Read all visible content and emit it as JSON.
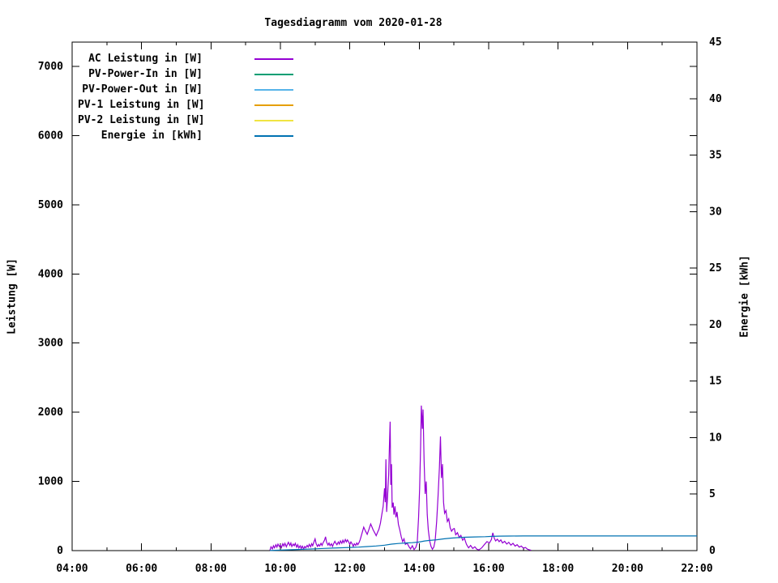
{
  "chart_data": {
    "type": "line",
    "title": "Tagesdiagramm vom 2020-01-28",
    "ylabel": "Leistung [W]",
    "y2label": "Energie [kWh]",
    "grid": false,
    "legend_position": "top-left",
    "x_range": [
      4,
      22
    ],
    "y_range": [
      0,
      7351
    ],
    "y2_range": [
      0,
      45
    ],
    "x_ticks": [
      {
        "h": 4,
        "label": "04:00"
      },
      {
        "h": 6,
        "label": "06:00"
      },
      {
        "h": 8,
        "label": "08:00"
      },
      {
        "h": 10,
        "label": "10:00"
      },
      {
        "h": 12,
        "label": "12:00"
      },
      {
        "h": 14,
        "label": "14:00"
      },
      {
        "h": 16,
        "label": "16:00"
      },
      {
        "h": 18,
        "label": "18:00"
      },
      {
        "h": 20,
        "label": "20:00"
      },
      {
        "h": 22,
        "label": "22:00"
      }
    ],
    "x_minor_ticks": [
      5,
      7,
      9,
      11,
      13,
      15,
      17,
      19,
      21
    ],
    "y_ticks": [
      {
        "v": 0,
        "label": "0"
      },
      {
        "v": 1000,
        "label": "1000"
      },
      {
        "v": 2000,
        "label": "2000"
      },
      {
        "v": 3000,
        "label": "3000"
      },
      {
        "v": 4000,
        "label": "4000"
      },
      {
        "v": 5000,
        "label": "5000"
      },
      {
        "v": 6000,
        "label": "6000"
      },
      {
        "v": 7000,
        "label": "7000"
      }
    ],
    "y2_ticks": [
      {
        "v": 0,
        "label": "0"
      },
      {
        "v": 5,
        "label": "5"
      },
      {
        "v": 10,
        "label": "10"
      },
      {
        "v": 15,
        "label": "15"
      },
      {
        "v": 20,
        "label": "20"
      },
      {
        "v": 25,
        "label": "25"
      },
      {
        "v": 30,
        "label": "30"
      },
      {
        "v": 35,
        "label": "35"
      },
      {
        "v": 40,
        "label": "40"
      },
      {
        "v": 45,
        "label": "45"
      }
    ],
    "series": [
      {
        "name": "AC Leistung in [W]",
        "color": "#9400d3",
        "axis": "y1",
        "points": [
          [
            9.7,
            5
          ],
          [
            9.73,
            55
          ],
          [
            9.77,
            25
          ],
          [
            9.8,
            70
          ],
          [
            9.83,
            40
          ],
          [
            9.87,
            85
          ],
          [
            9.9,
            50
          ],
          [
            9.93,
            95
          ],
          [
            9.97,
            60
          ],
          [
            10.0,
            80
          ],
          [
            10.03,
            45
          ],
          [
            10.07,
            100
          ],
          [
            10.1,
            65
          ],
          [
            10.13,
            105
          ],
          [
            10.17,
            55
          ],
          [
            10.2,
            90
          ],
          [
            10.23,
            120
          ],
          [
            10.27,
            75
          ],
          [
            10.3,
            110
          ],
          [
            10.33,
            60
          ],
          [
            10.37,
            95
          ],
          [
            10.4,
            70
          ],
          [
            10.43,
            105
          ],
          [
            10.47,
            50
          ],
          [
            10.5,
            85
          ],
          [
            10.53,
            40
          ],
          [
            10.57,
            70
          ],
          [
            10.6,
            30
          ],
          [
            10.63,
            65
          ],
          [
            10.67,
            25
          ],
          [
            10.7,
            60
          ],
          [
            10.73,
            40
          ],
          [
            10.77,
            75
          ],
          [
            10.8,
            50
          ],
          [
            10.83,
            90
          ],
          [
            10.87,
            55
          ],
          [
            10.9,
            100
          ],
          [
            10.93,
            70
          ],
          [
            10.97,
            130
          ],
          [
            11.0,
            170
          ],
          [
            11.03,
            100
          ],
          [
            11.07,
            60
          ],
          [
            11.1,
            90
          ],
          [
            11.13,
            65
          ],
          [
            11.17,
            105
          ],
          [
            11.2,
            75
          ],
          [
            11.23,
            115
          ],
          [
            11.27,
            150
          ],
          [
            11.3,
            200
          ],
          [
            11.33,
            120
          ],
          [
            11.37,
            80
          ],
          [
            11.4,
            110
          ],
          [
            11.43,
            70
          ],
          [
            11.47,
            100
          ],
          [
            11.5,
            60
          ],
          [
            11.53,
            95
          ],
          [
            11.57,
            135
          ],
          [
            11.6,
            105
          ],
          [
            11.63,
            85
          ],
          [
            11.67,
            125
          ],
          [
            11.7,
            95
          ],
          [
            11.73,
            140
          ],
          [
            11.77,
            105
          ],
          [
            11.8,
            150
          ],
          [
            11.83,
            115
          ],
          [
            11.87,
            160
          ],
          [
            11.9,
            125
          ],
          [
            11.93,
            155
          ],
          [
            11.97,
            120
          ],
          [
            12.0,
            90
          ],
          [
            12.03,
            125
          ],
          [
            12.07,
            95
          ],
          [
            12.1,
            60
          ],
          [
            12.13,
            100
          ],
          [
            12.17,
            75
          ],
          [
            12.2,
            110
          ],
          [
            12.23,
            85
          ],
          [
            12.27,
            120
          ],
          [
            12.3,
            160
          ],
          [
            12.35,
            250
          ],
          [
            12.4,
            340
          ],
          [
            12.45,
            285
          ],
          [
            12.5,
            235
          ],
          [
            12.55,
            305
          ],
          [
            12.6,
            385
          ],
          [
            12.63,
            350
          ],
          [
            12.67,
            300
          ],
          [
            12.72,
            255
          ],
          [
            12.76,
            215
          ],
          [
            12.8,
            265
          ],
          [
            12.84,
            310
          ],
          [
            12.88,
            395
          ],
          [
            12.92,
            520
          ],
          [
            12.96,
            640
          ],
          [
            13.0,
            900
          ],
          [
            13.02,
            700
          ],
          [
            13.04,
            1320
          ],
          [
            13.06,
            560
          ],
          [
            13.09,
            820
          ],
          [
            13.12,
            1100
          ],
          [
            13.14,
            1500
          ],
          [
            13.16,
            1863
          ],
          [
            13.18,
            950
          ],
          [
            13.2,
            1250
          ],
          [
            13.22,
            620
          ],
          [
            13.25,
            694
          ],
          [
            13.27,
            520
          ],
          [
            13.3,
            640
          ],
          [
            13.33,
            480
          ],
          [
            13.36,
            560
          ],
          [
            13.4,
            380
          ],
          [
            13.44,
            300
          ],
          [
            13.48,
            200
          ],
          [
            13.52,
            130
          ],
          [
            13.56,
            170
          ],
          [
            13.6,
            90
          ],
          [
            13.65,
            110
          ],
          [
            13.7,
            60
          ],
          [
            13.75,
            25
          ],
          [
            13.8,
            70
          ],
          [
            13.85,
            15
          ],
          [
            13.9,
            45
          ],
          [
            13.94,
            110
          ],
          [
            13.98,
            480
          ],
          [
            14.01,
            900
          ],
          [
            14.04,
            1500
          ],
          [
            14.06,
            2097
          ],
          [
            14.09,
            1760
          ],
          [
            14.11,
            2040
          ],
          [
            14.14,
            1300
          ],
          [
            14.17,
            820
          ],
          [
            14.2,
            1000
          ],
          [
            14.23,
            520
          ],
          [
            14.26,
            300
          ],
          [
            14.3,
            140
          ],
          [
            14.34,
            60
          ],
          [
            14.38,
            20
          ],
          [
            14.42,
            50
          ],
          [
            14.46,
            150
          ],
          [
            14.5,
            420
          ],
          [
            14.54,
            780
          ],
          [
            14.58,
            1200
          ],
          [
            14.61,
            1650
          ],
          [
            14.64,
            1050
          ],
          [
            14.67,
            1250
          ],
          [
            14.7,
            700
          ],
          [
            14.73,
            540
          ],
          [
            14.77,
            580
          ],
          [
            14.81,
            420
          ],
          [
            14.85,
            460
          ],
          [
            14.89,
            330
          ],
          [
            14.93,
            280
          ],
          [
            14.97,
            310
          ],
          [
            15.01,
            320
          ],
          [
            15.05,
            230
          ],
          [
            15.1,
            260
          ],
          [
            15.15,
            190
          ],
          [
            15.2,
            220
          ],
          [
            15.25,
            150
          ],
          [
            15.3,
            180
          ],
          [
            15.36,
            90
          ],
          [
            15.42,
            40
          ],
          [
            15.48,
            75
          ],
          [
            15.54,
            30
          ],
          [
            15.6,
            55
          ],
          [
            15.66,
            20
          ],
          [
            15.72,
            10
          ],
          [
            15.8,
            40
          ],
          [
            15.88,
            90
          ],
          [
            15.95,
            130
          ],
          [
            16.02,
            110
          ],
          [
            16.08,
            160
          ],
          [
            16.12,
            257
          ],
          [
            16.16,
            180
          ],
          [
            16.2,
            140
          ],
          [
            16.25,
            165
          ],
          [
            16.3,
            130
          ],
          [
            16.35,
            155
          ],
          [
            16.4,
            110
          ],
          [
            16.46,
            135
          ],
          [
            16.52,
            95
          ],
          [
            16.58,
            120
          ],
          [
            16.64,
            80
          ],
          [
            16.7,
            105
          ],
          [
            16.76,
            65
          ],
          [
            16.82,
            85
          ],
          [
            16.88,
            50
          ],
          [
            16.94,
            65
          ],
          [
            17.0,
            35
          ],
          [
            17.06,
            45
          ],
          [
            17.12,
            20
          ],
          [
            17.18,
            10
          ],
          [
            17.22,
            5
          ]
        ]
      },
      {
        "name": "PV-Power-In in [W]",
        "color": "#009e73",
        "axis": "y1",
        "points": []
      },
      {
        "name": "PV-Power-Out in [W]",
        "color": "#56b4e9",
        "axis": "y1",
        "points": []
      },
      {
        "name": "PV-1 Leistung in [W]",
        "color": "#e69f00",
        "axis": "y1",
        "points": []
      },
      {
        "name": "PV-2 Leistung in [W]",
        "color": "#f0e442",
        "axis": "y1",
        "points": []
      },
      {
        "name": "Energie in [kWh]",
        "color": "#0072b2",
        "axis": "y2",
        "points": [
          [
            9.7,
            0.01
          ],
          [
            10.0,
            0.04
          ],
          [
            10.25,
            0.07
          ],
          [
            10.5,
            0.1
          ],
          [
            10.75,
            0.13
          ],
          [
            11.0,
            0.16
          ],
          [
            11.25,
            0.19
          ],
          [
            11.5,
            0.22
          ],
          [
            11.75,
            0.25
          ],
          [
            12.0,
            0.28
          ],
          [
            12.25,
            0.31
          ],
          [
            12.5,
            0.36
          ],
          [
            12.75,
            0.41
          ],
          [
            13.0,
            0.48
          ],
          [
            13.2,
            0.57
          ],
          [
            13.4,
            0.63
          ],
          [
            13.6,
            0.67
          ],
          [
            13.8,
            0.7
          ],
          [
            14.0,
            0.76
          ],
          [
            14.15,
            0.85
          ],
          [
            14.3,
            0.9
          ],
          [
            14.5,
            0.96
          ],
          [
            14.7,
            1.04
          ],
          [
            14.9,
            1.1
          ],
          [
            15.1,
            1.15
          ],
          [
            15.3,
            1.18
          ],
          [
            15.6,
            1.21
          ],
          [
            15.9,
            1.23
          ],
          [
            16.1,
            1.26
          ],
          [
            16.3,
            1.28
          ],
          [
            16.6,
            1.29
          ],
          [
            17.0,
            1.3
          ],
          [
            17.25,
            1.3
          ],
          [
            22.0,
            1.3
          ]
        ]
      }
    ]
  }
}
